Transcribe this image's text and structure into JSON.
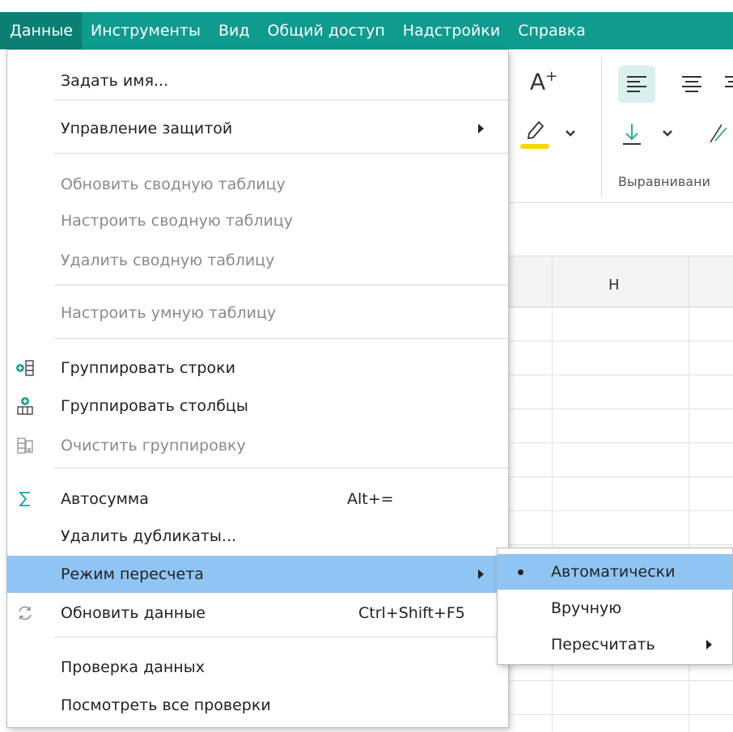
{
  "menubar": {
    "items": [
      {
        "label": "Данные"
      },
      {
        "label": "Инструменты"
      },
      {
        "label": "Вид"
      },
      {
        "label": "Общий доступ"
      },
      {
        "label": "Надстройки"
      },
      {
        "label": "Справка"
      }
    ],
    "active_index": 0
  },
  "toolbar": {
    "font_size_glyph": "A",
    "font_size_plus": "+",
    "alignment_group_label": "Выравнивани"
  },
  "grid": {
    "column_header": "H"
  },
  "dropdown": {
    "items": [
      {
        "label": "Задать имя..."
      },
      {
        "label": "Управление защитой"
      },
      {
        "label": "Обновить сводную таблицу"
      },
      {
        "label": "Настроить сводную таблицу"
      },
      {
        "label": "Удалить сводную таблицу"
      },
      {
        "label": "Настроить умную таблицу"
      },
      {
        "label": "Группировать строки",
        "icon": "group-rows-icon"
      },
      {
        "label": "Группировать столбцы",
        "icon": "group-columns-icon"
      },
      {
        "label": "Очистить группировку",
        "icon": "clear-grouping-icon"
      },
      {
        "label": "Автосумма",
        "shortcut": "Alt+=",
        "icon": "sigma-icon"
      },
      {
        "label": "Удалить дубликаты..."
      },
      {
        "label": "Режим пересчета"
      },
      {
        "label": "Обновить данные",
        "shortcut": "Ctrl+Shift+F5",
        "icon": "refresh-icon"
      },
      {
        "label": "Проверка данных"
      },
      {
        "label": "Посмотреть все проверки"
      }
    ]
  },
  "submenu": {
    "items": [
      {
        "label": "Автоматически",
        "selected": true
      },
      {
        "label": "Вручную"
      },
      {
        "label": "Пересчитать"
      }
    ]
  },
  "colors": {
    "menubar": "#0f9b8e",
    "menubar_active": "#0b7f74",
    "highlight": "#90c5f3",
    "accent_teal": "#1aa394",
    "highlighter_yellow": "#f5d800",
    "disabled_text": "#8a8a8a"
  }
}
